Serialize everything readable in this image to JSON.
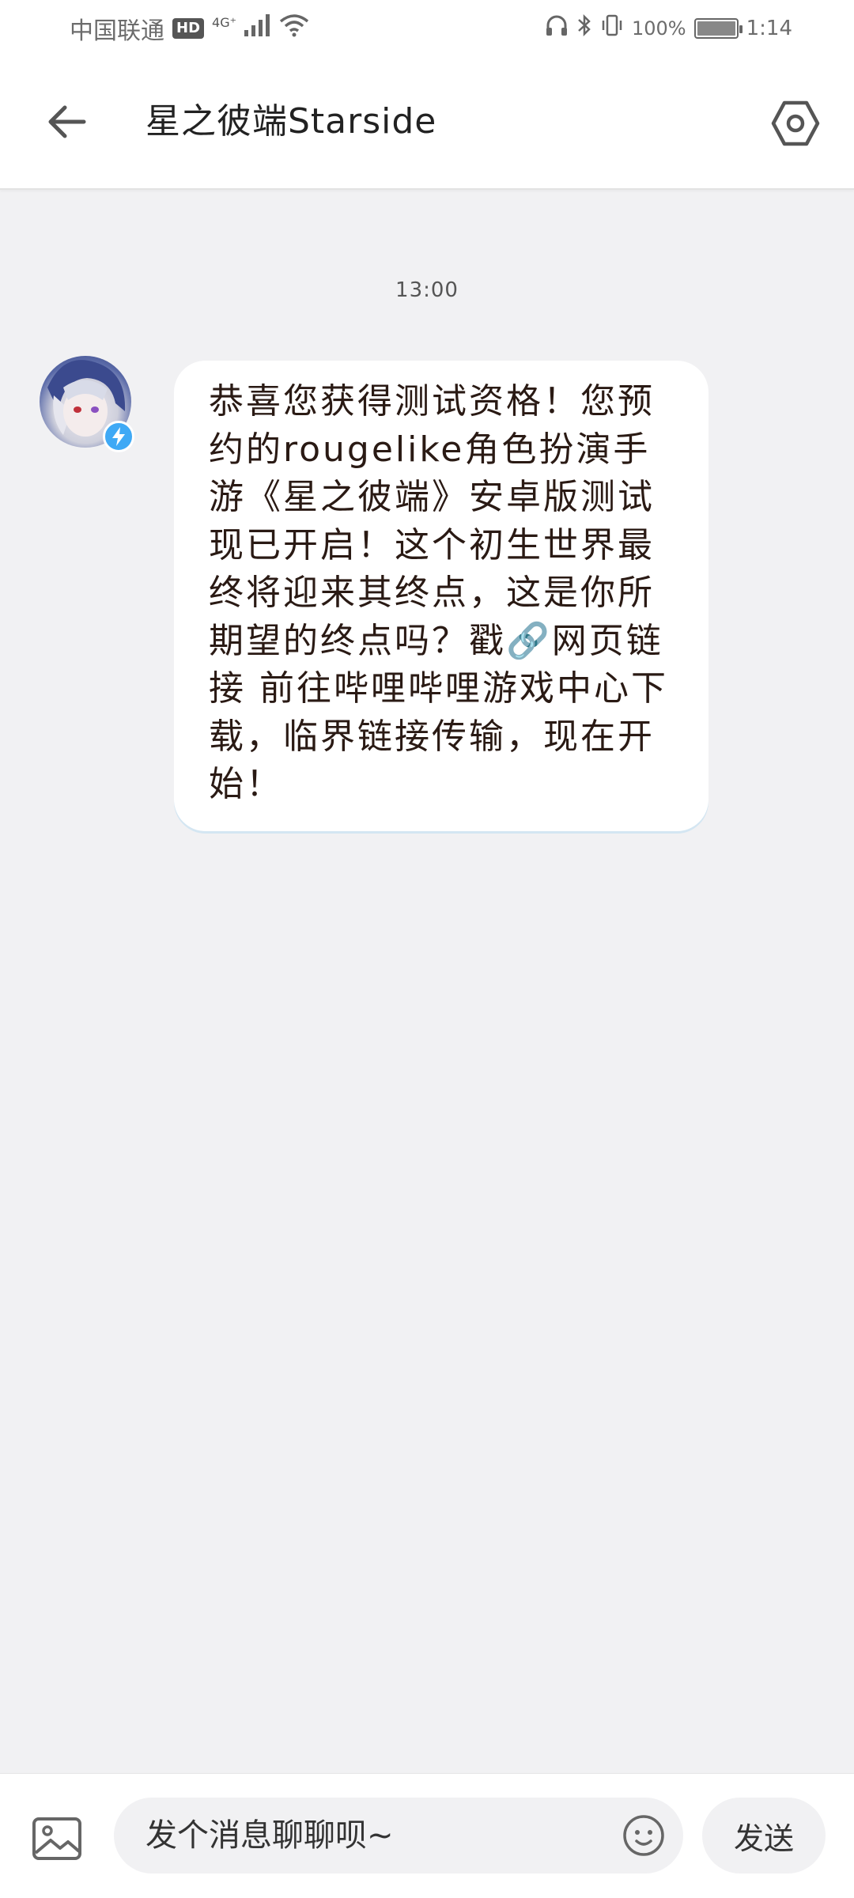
{
  "status_bar": {
    "carrier": "中国联通",
    "hd_badge": "HD",
    "network_type": "4G⁺",
    "battery_percent": "100%",
    "time": "1:14"
  },
  "header": {
    "title": "星之彼端Starside",
    "back_icon": "back-arrow-icon",
    "settings_icon": "settings-hexagon-icon"
  },
  "chat": {
    "timestamp": "13:00",
    "messages": [
      {
        "sender_avatar": "starside-avatar",
        "verified_icon": "lightning-badge-icon",
        "text": "恭喜您获得测试资格！您预约的rougelike角色扮演手游《星之彼端》安卓版测试现已开启！这个初生世界最终将迎来其终点，这是你所期望的终点吗？戳🔗网页链接 前往哔哩哔哩游戏中心下载，临界链接传输，现在开始！"
      }
    ]
  },
  "input_bar": {
    "image_icon": "image-icon",
    "placeholder": "发个消息聊聊呗~",
    "emoji_icon": "emoji-icon",
    "send_label": "发送"
  },
  "colors": {
    "background": "#f1f1f3",
    "bubble": "#ffffff",
    "accent_badge": "#3fa9f5",
    "text": "#2a1a14"
  }
}
